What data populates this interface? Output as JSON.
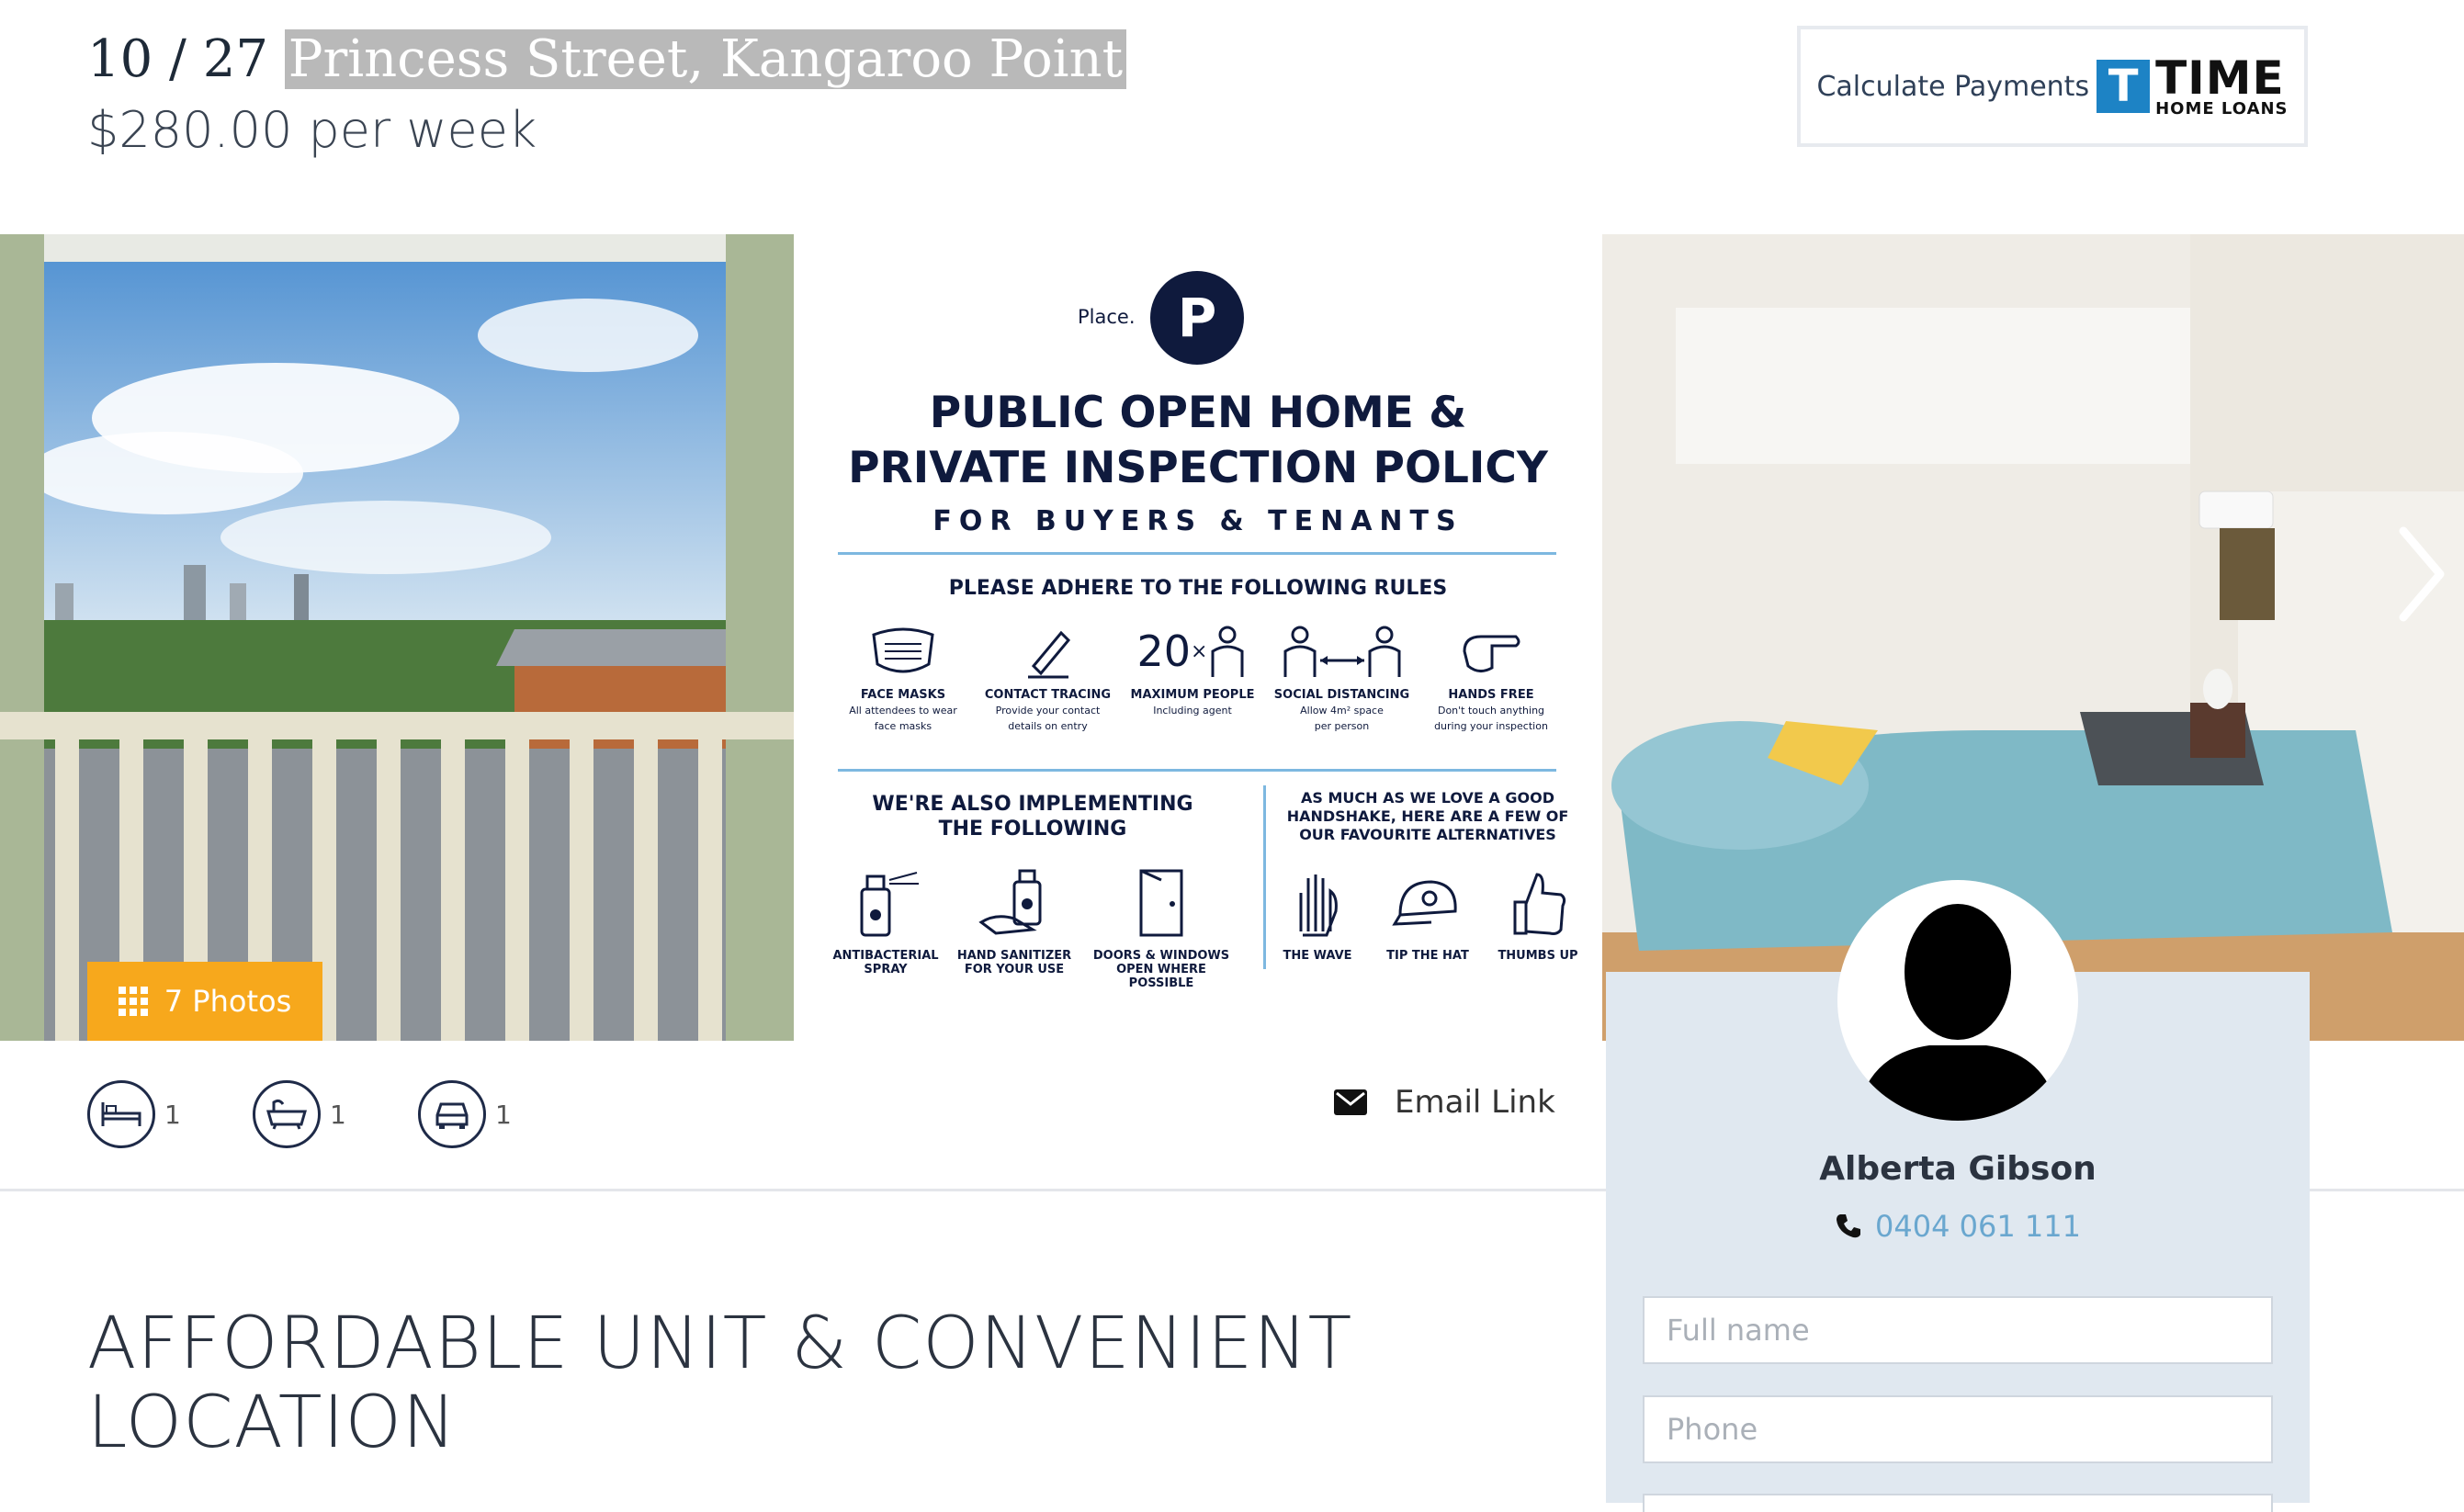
{
  "listing": {
    "unit": "10 / 27",
    "street": "Princess Street, Kangaroo Point",
    "price": "$280.00 per week"
  },
  "calculator": {
    "label": "Calculate Payments",
    "logo_letter": "T",
    "logo_word": "TIME",
    "logo_sub": "HOME LOANS"
  },
  "gallery": {
    "photos_label": "7 Photos",
    "poster": {
      "brand": "Place.",
      "brand_letter": "P",
      "heading_line1": "PUBLIC OPEN HOME &",
      "heading_line2": "PRIVATE INSPECTION POLICY",
      "subheading": "FOR BUYERS & TENANTS",
      "rules_title": "PLEASE ADHERE TO THE FOLLOWING RULES",
      "rules": [
        {
          "title": "FACE MASKS",
          "desc1": "All attendees to wear",
          "desc2": "face masks"
        },
        {
          "title": "CONTACT TRACING",
          "desc1": "Provide your contact",
          "desc2": "details on entry"
        },
        {
          "title": "MAXIMUM PEOPLE",
          "desc1": "Including agent",
          "desc2": "",
          "count": "20"
        },
        {
          "title": "SOCIAL DISTANCING",
          "desc1": "Allow 4m² space",
          "desc2": "per person"
        },
        {
          "title": "HANDS FREE",
          "desc1": "Don't touch anything",
          "desc2": "during your inspection"
        }
      ],
      "also_line1": "WE'RE ALSO IMPLEMENTING",
      "also_line2": "THE FOLLOWING",
      "also_items": [
        {
          "line1": "ANTIBACTERIAL",
          "line2": "SPRAY"
        },
        {
          "line1": "HAND SANITIZER",
          "line2": "FOR YOUR USE"
        },
        {
          "line1": "DOORS & WINDOWS",
          "line2": "OPEN WHERE POSSIBLE"
        }
      ],
      "handshake_line1": "AS MUCH AS WE LOVE A GOOD",
      "handshake_line2": "HANDSHAKE, HERE ARE A FEW OF",
      "handshake_line3": "OUR FAVOURITE ALTERNATIVES",
      "alternatives": [
        "THE WAVE",
        "TIP THE HAT",
        "THUMBS UP"
      ]
    }
  },
  "features": {
    "bedrooms": "1",
    "bathrooms": "1",
    "parking": "1"
  },
  "email_link": "Email Link",
  "headline_line1": "AFFORDABLE UNIT & CONVENIENT",
  "headline_line2": "LOCATION",
  "agent": {
    "name": "Alberta Gibson",
    "phone": "0404 061 111"
  },
  "form": {
    "fullname_placeholder": "Full name",
    "phone_placeholder": "Phone"
  },
  "colors": {
    "accent_orange": "#f7a81c",
    "navy": "#0f1a3d",
    "agent_bg": "#e0e8f0",
    "phone_link": "#6aa7cf",
    "time_blue": "#1d83c5"
  }
}
